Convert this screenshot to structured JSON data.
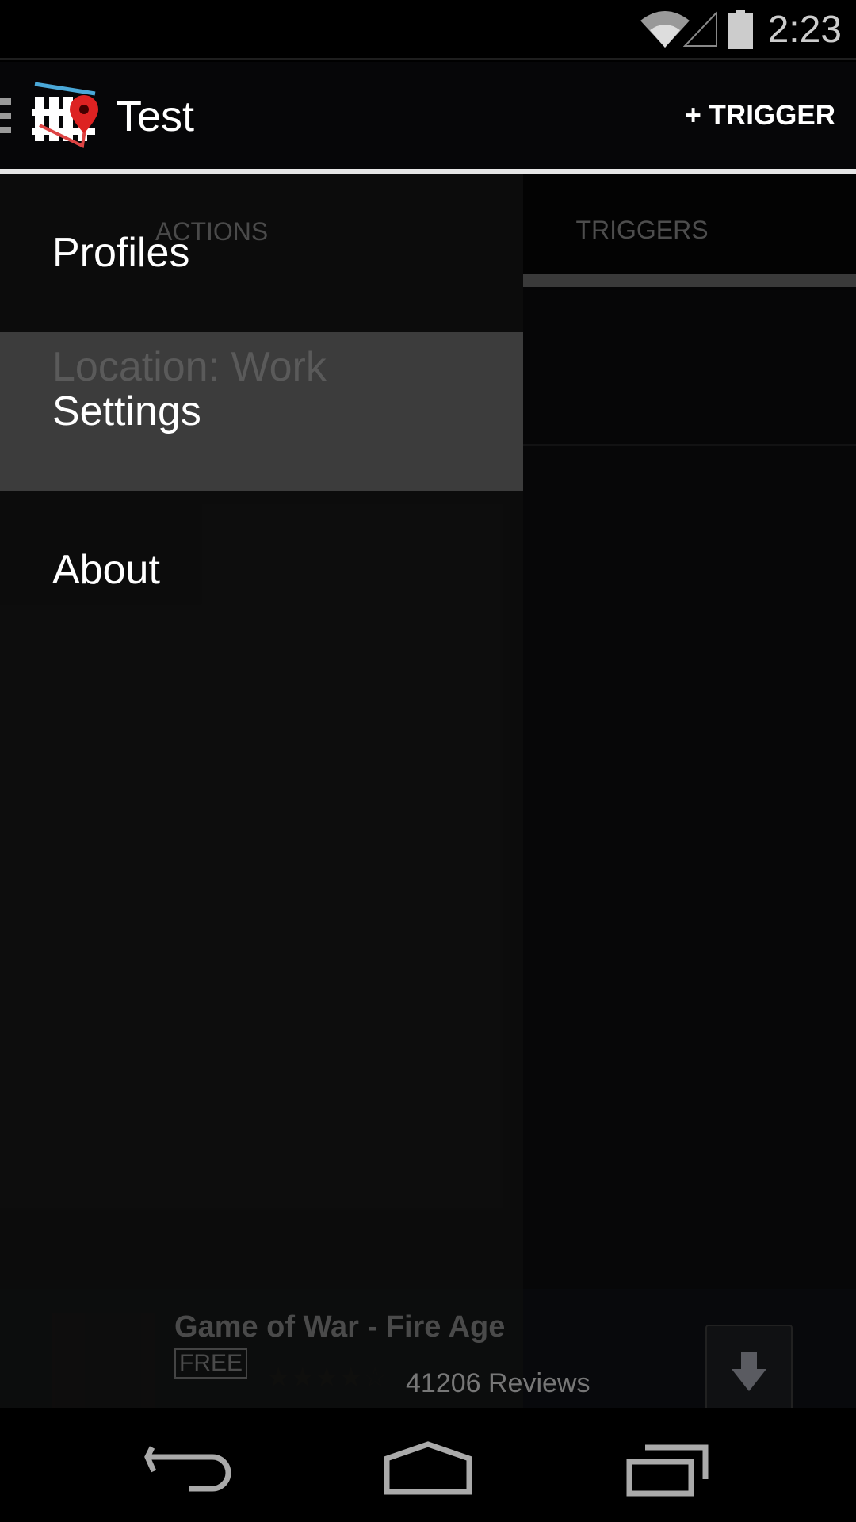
{
  "status_bar": {
    "time": "2:23",
    "icons": [
      "wifi-icon",
      "signal-icon",
      "battery-icon"
    ]
  },
  "action_bar": {
    "title": "Test",
    "add_trigger_label": "+ TRIGGER",
    "icons": [
      "drawer-toggle-icon",
      "app-logo-icon"
    ]
  },
  "tabs": [
    {
      "label": "ACTIONS"
    },
    {
      "label": "TRIGGERS",
      "selected": true
    }
  ],
  "list": {
    "items": [
      {
        "label": "Location: Work"
      }
    ]
  },
  "drawer": {
    "items": [
      {
        "label": "Profiles"
      },
      {
        "label": "Settings",
        "selected": true
      },
      {
        "label": "About"
      }
    ]
  },
  "ad": {
    "title": "Game of War - Fire Age",
    "price": "FREE",
    "rating": 4,
    "reviews": "41206 Reviews",
    "icon": "download-icon"
  },
  "nav_bar": {
    "icons": [
      "back-icon",
      "home-icon",
      "recents-icon"
    ]
  },
  "colors": {
    "highlight": "#3c3c3c",
    "tab_indicator": "#5a5a5a"
  }
}
